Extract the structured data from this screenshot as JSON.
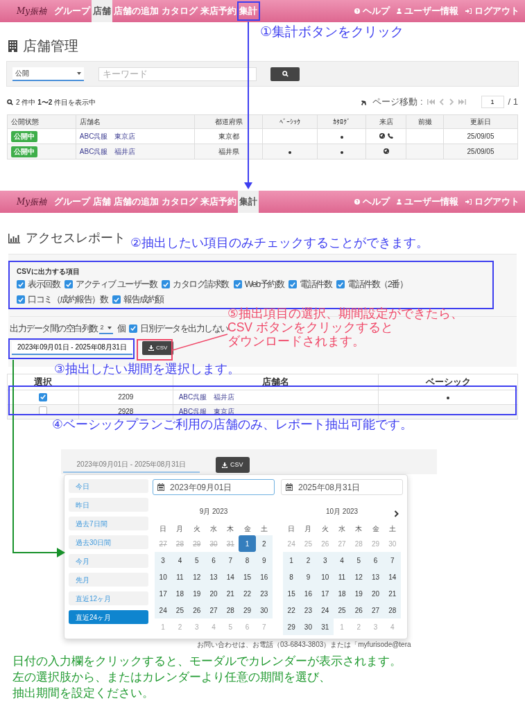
{
  "store_screen": {
    "nav": {
      "logo": "My振袖",
      "items": [
        {
          "label": "グループ",
          "selected": false
        },
        {
          "label": "店舗",
          "selected": true
        },
        {
          "label": "店舗の追加",
          "selected": false
        },
        {
          "label": "カタログ",
          "selected": false
        },
        {
          "label": "来店予約",
          "selected": false
        },
        {
          "label": "集計",
          "selected": false
        }
      ],
      "right": [
        {
          "label": "ヘルプ",
          "kind": "help"
        },
        {
          "label": "ユーザー情報",
          "kind": "user"
        },
        {
          "label": "ログアウト",
          "kind": "logout"
        }
      ]
    },
    "title": "店舗管理",
    "filter": {
      "status": "公開",
      "keyword_placeholder": "キーワード"
    },
    "result_summary": "2 件中 **1〜2** 件目を表示中",
    "pager": {
      "label": "ページ移動 :",
      "page": "1",
      "total": "/ 1"
    },
    "table": {
      "columns": [
        "公開状態",
        "店舗名",
        "都道府県",
        "ﾍﾞｰｼｯｸ",
        "ｶﾀﾛｸﾞ",
        "来店",
        "前撮",
        "更新日"
      ],
      "rows": [
        {
          "status": "公開中",
          "name": "ABC呉服　東京店",
          "prefecture": "東京都",
          "basic": false,
          "catalog": true,
          "web": true,
          "phone": true,
          "updated": "25/09/05"
        },
        {
          "status": "公開中",
          "name": "ABC呉服　福井店",
          "prefecture": "福井県",
          "basic": true,
          "catalog": true,
          "web": true,
          "phone": false,
          "updated": "25/09/05"
        }
      ]
    },
    "callout": "①集計ボタンをクリック"
  },
  "report_screen": {
    "nav": {
      "logo": "My振袖",
      "items": [
        {
          "label": "グループ",
          "selected": false
        },
        {
          "label": "店舗",
          "selected": false
        },
        {
          "label": "店舗の追加",
          "selected": false
        },
        {
          "label": "カタログ",
          "selected": false
        },
        {
          "label": "来店予約",
          "selected": false
        },
        {
          "label": "集計",
          "selected": true
        }
      ],
      "right": [
        {
          "label": "ヘルプ",
          "kind": "help"
        },
        {
          "label": "ユーザー情報",
          "kind": "user"
        },
        {
          "label": "ログアウト",
          "kind": "logout"
        }
      ]
    },
    "title": "アクセスレポート",
    "csv_items_label": "CSVに出力する項目",
    "csv_items": [
      {
        "label": "表示回数",
        "checked": true
      },
      {
        "label": "アクティブ ユーザー数",
        "checked": true
      },
      {
        "label": "カタログ請求数",
        "checked": true
      },
      {
        "label": "Web予約数",
        "checked": true
      },
      {
        "label": "電話件数",
        "checked": true
      },
      {
        "label": "電話件数（2番）",
        "checked": true
      },
      {
        "label": "口コミ（成約報告）数",
        "checked": true
      },
      {
        "label": "報告成約額",
        "checked": true
      }
    ],
    "blank_columns": {
      "label": "出力データ間の空白列数",
      "value": "2",
      "unit": "個"
    },
    "no_daily": {
      "label": "日別データを出力しない",
      "checked": true
    },
    "date_range": "2023年09月01日 - 2025年08月31日",
    "csv_button": "CSV",
    "table": {
      "columns": {
        "column_1": "選択",
        "column_3": "店舗名",
        "column_4": "ベーシック"
      },
      "rows": [
        {
          "selected": true,
          "id": "2209",
          "name": "ABC呉服　福井店",
          "basic": true
        },
        {
          "selected": false,
          "id": "2928",
          "name": "ABC呉服　東京店",
          "basic": false
        }
      ]
    },
    "callouts": {
      "step2": "②抽出したい項目のみチェックすることができます。",
      "step3": "③抽出したい期間を選択します。",
      "step4": "④ベーシックプランご利用の店舗のみ、レポート抽出可能です。",
      "step5": [
        "⑤抽出項目の選択、期間設定ができたら、",
        "CSV ボタンをクリックすると",
        "ダウンロードされます。"
      ]
    }
  },
  "datepicker_screen": {
    "date_range": "2023年09月01日 - 2025年08月31日",
    "csv_button": "CSV",
    "ranges": [
      {
        "label": "今日",
        "selected": false
      },
      {
        "label": "昨日",
        "selected": false
      },
      {
        "label": "過去7日間",
        "selected": false
      },
      {
        "label": "過去30日間",
        "selected": false
      },
      {
        "label": "今月",
        "selected": false
      },
      {
        "label": "先月",
        "selected": false
      },
      {
        "label": "直近12ヶ月",
        "selected": false
      },
      {
        "label": "直近24ヶ月",
        "selected": true
      }
    ],
    "start": "2023年09月01日",
    "end": "2025年08月31日",
    "months": [
      {
        "title": "9月 2023",
        "next_arrow": false,
        "weekdays": [
          "日",
          "月",
          "火",
          "水",
          "木",
          "金",
          "土"
        ],
        "weeks": [
          [
            {
              "day": "27",
              "kind": "disabled"
            },
            {
              "day": "28",
              "kind": "disabled"
            },
            {
              "day": "29",
              "kind": "disabled"
            },
            {
              "day": "30",
              "kind": "disabled"
            },
            {
              "day": "31",
              "kind": "disabled"
            },
            {
              "day": "1",
              "kind": "start"
            },
            {
              "day": "2",
              "kind": "in_range"
            }
          ],
          [
            {
              "day": "3",
              "kind": "in_range"
            },
            {
              "day": "4",
              "kind": "in_range"
            },
            {
              "day": "5",
              "kind": "in_range"
            },
            {
              "day": "6",
              "kind": "in_range"
            },
            {
              "day": "7",
              "kind": "in_range"
            },
            {
              "day": "8",
              "kind": "in_range"
            },
            {
              "day": "9",
              "kind": "in_range"
            }
          ],
          [
            {
              "day": "10",
              "kind": "in_range"
            },
            {
              "day": "11",
              "kind": "in_range"
            },
            {
              "day": "12",
              "kind": "in_range"
            },
            {
              "day": "13",
              "kind": "in_range"
            },
            {
              "day": "14",
              "kind": "in_range"
            },
            {
              "day": "15",
              "kind": "in_range"
            },
            {
              "day": "16",
              "kind": "in_range"
            }
          ],
          [
            {
              "day": "17",
              "kind": "in_range"
            },
            {
              "day": "18",
              "kind": "in_range"
            },
            {
              "day": "19",
              "kind": "in_range"
            },
            {
              "day": "20",
              "kind": "in_range"
            },
            {
              "day": "21",
              "kind": "in_range"
            },
            {
              "day": "22",
              "kind": "in_range"
            },
            {
              "day": "23",
              "kind": "in_range"
            }
          ],
          [
            {
              "day": "24",
              "kind": "in_range"
            },
            {
              "day": "25",
              "kind": "in_range"
            },
            {
              "day": "26",
              "kind": "in_range"
            },
            {
              "day": "27",
              "kind": "in_range"
            },
            {
              "day": "28",
              "kind": "in_range"
            },
            {
              "day": "29",
              "kind": "in_range"
            },
            {
              "day": "30",
              "kind": "in_range"
            }
          ],
          [
            {
              "day": "1",
              "kind": "off"
            },
            {
              "day": "2",
              "kind": "off"
            },
            {
              "day": "3",
              "kind": "off"
            },
            {
              "day": "4",
              "kind": "off"
            },
            {
              "day": "5",
              "kind": "off"
            },
            {
              "day": "6",
              "kind": "off"
            },
            {
              "day": "7",
              "kind": "off"
            }
          ]
        ]
      },
      {
        "title": "10月 2023",
        "next_arrow": true,
        "weekdays": [
          "日",
          "月",
          "火",
          "水",
          "木",
          "金",
          "土"
        ],
        "weeks": [
          [
            {
              "day": "24",
              "kind": "off"
            },
            {
              "day": "25",
              "kind": "off"
            },
            {
              "day": "26",
              "kind": "off"
            },
            {
              "day": "27",
              "kind": "off"
            },
            {
              "day": "28",
              "kind": "off"
            },
            {
              "day": "29",
              "kind": "off"
            },
            {
              "day": "30",
              "kind": "off"
            }
          ],
          [
            {
              "day": "1",
              "kind": "in_range"
            },
            {
              "day": "2",
              "kind": "in_range"
            },
            {
              "day": "3",
              "kind": "in_range"
            },
            {
              "day": "4",
              "kind": "in_range"
            },
            {
              "day": "5",
              "kind": "in_range"
            },
            {
              "day": "6",
              "kind": "in_range"
            },
            {
              "day": "7",
              "kind": "in_range"
            }
          ],
          [
            {
              "day": "8",
              "kind": "in_range"
            },
            {
              "day": "9",
              "kind": "in_range"
            },
            {
              "day": "10",
              "kind": "in_range"
            },
            {
              "day": "11",
              "kind": "in_range"
            },
            {
              "day": "12",
              "kind": "in_range"
            },
            {
              "day": "13",
              "kind": "in_range"
            },
            {
              "day": "14",
              "kind": "in_range"
            }
          ],
          [
            {
              "day": "15",
              "kind": "in_range"
            },
            {
              "day": "16",
              "kind": "in_range"
            },
            {
              "day": "17",
              "kind": "in_range"
            },
            {
              "day": "18",
              "kind": "in_range"
            },
            {
              "day": "19",
              "kind": "in_range"
            },
            {
              "day": "20",
              "kind": "in_range"
            },
            {
              "day": "21",
              "kind": "in_range"
            }
          ],
          [
            {
              "day": "22",
              "kind": "in_range"
            },
            {
              "day": "23",
              "kind": "in_range"
            },
            {
              "day": "24",
              "kind": "in_range"
            },
            {
              "day": "25",
              "kind": "in_range"
            },
            {
              "day": "26",
              "kind": "in_range"
            },
            {
              "day": "27",
              "kind": "in_range"
            },
            {
              "day": "28",
              "kind": "in_range"
            }
          ],
          [
            {
              "day": "29",
              "kind": "in_range"
            },
            {
              "day": "30",
              "kind": "in_range"
            },
            {
              "day": "31",
              "kind": "in_range"
            },
            {
              "day": "1",
              "kind": "off"
            },
            {
              "day": "2",
              "kind": "off"
            },
            {
              "day": "3",
              "kind": "off"
            },
            {
              "day": "4",
              "kind": "off"
            }
          ]
        ]
      }
    ],
    "footer_note": {
      "text": "お問い合わせは、お電話（03-6843-3803）または「",
      "link": "myfurisode@tera"
    }
  },
  "instructions": [
    "日付の入力欄をクリックすると、モーダルでカレンダーが表示されます。",
    "左の選択肢から、またはカレンダーより任意の期間を選び、",
    "抽出期間を設定ください。"
  ]
}
